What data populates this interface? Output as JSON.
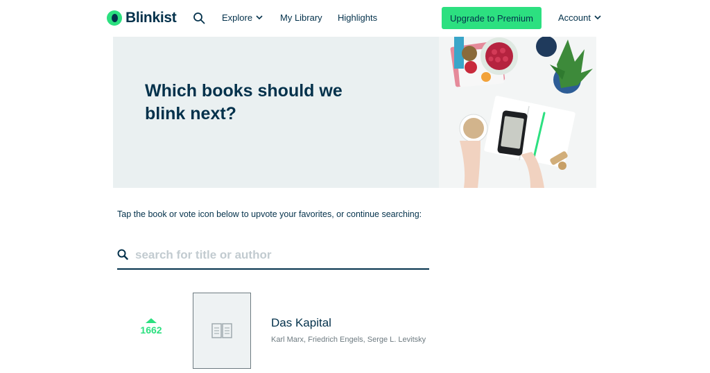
{
  "nav": {
    "logo_text": "Blinkist",
    "explore_label": "Explore",
    "library_label": "My Library",
    "highlights_label": "Highlights",
    "premium_label": "Upgrade to Premium",
    "account_label": "Account"
  },
  "hero": {
    "title": "Which books should we blink next?"
  },
  "main": {
    "instructions": "Tap the book or vote icon below to upvote your favorites, or continue searching:",
    "search": {
      "placeholder": "search for title or author",
      "value": ""
    }
  },
  "books": [
    {
      "vote_count": "1662",
      "title": "Das Kapital",
      "authors": "Karl Marx, Friedrich Engels, Serge L. Levitsky"
    }
  ],
  "icons": {
    "logo": "blinkist-logo-icon",
    "search": "search-icon",
    "chevron": "chevron-down-icon",
    "vote": "upvote-arrow-icon",
    "book": "open-book-icon"
  },
  "colors": {
    "brand_green": "#2ce080",
    "navy": "#03314b",
    "hero_bg": "#eaf0f1",
    "muted": "#6d7a80",
    "placeholder": "#c2cbd0"
  }
}
